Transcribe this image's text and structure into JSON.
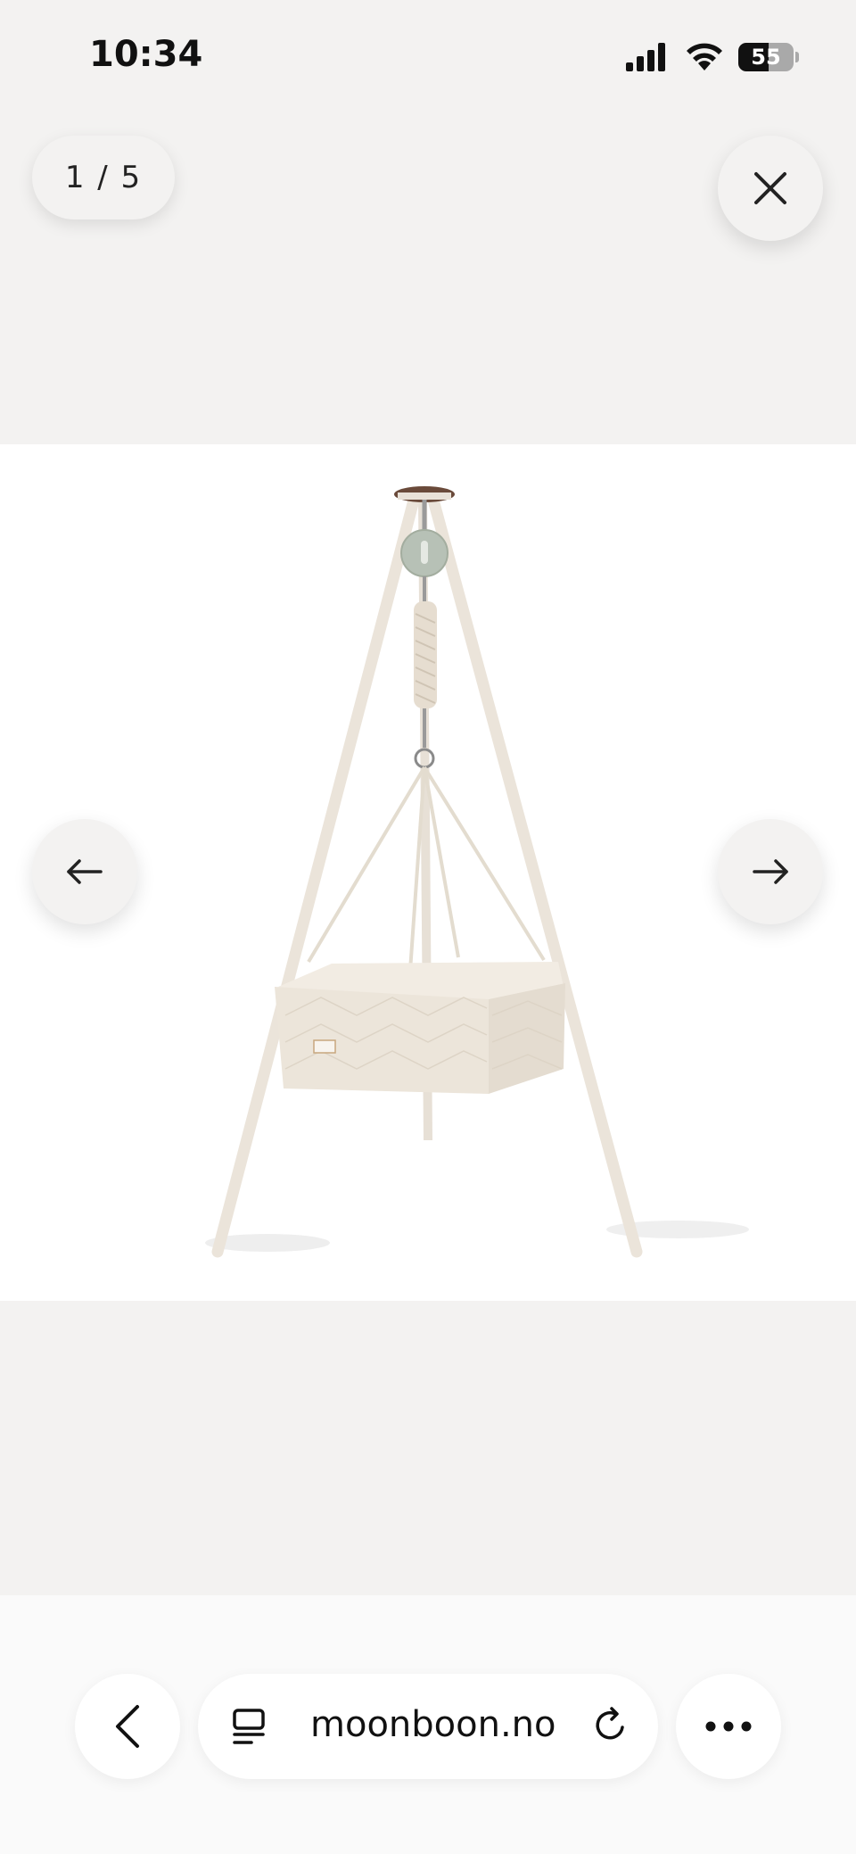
{
  "status_bar": {
    "time": "10:34",
    "battery_level": "55",
    "icons": [
      "signal-icon",
      "wifi-icon",
      "battery-icon"
    ]
  },
  "gallery": {
    "counter": "1 / 5",
    "current_index": 1,
    "total": 5,
    "image_alt": "Hanging cradle on tripod stand",
    "icons": {
      "close": "close-icon",
      "prev": "arrow-left-icon",
      "next": "arrow-right-icon"
    }
  },
  "browser_toolbar": {
    "url": "moonboon.no",
    "icons": [
      "chevron-left-icon",
      "tabs-icon",
      "reload-icon",
      "more-icon"
    ]
  },
  "colors": {
    "background": "#f3f2f1",
    "image_background": "#ffffff",
    "toolbar_background": "#fafafa",
    "cradle_fabric": "#eee8df",
    "stand": "#ede6dc"
  }
}
